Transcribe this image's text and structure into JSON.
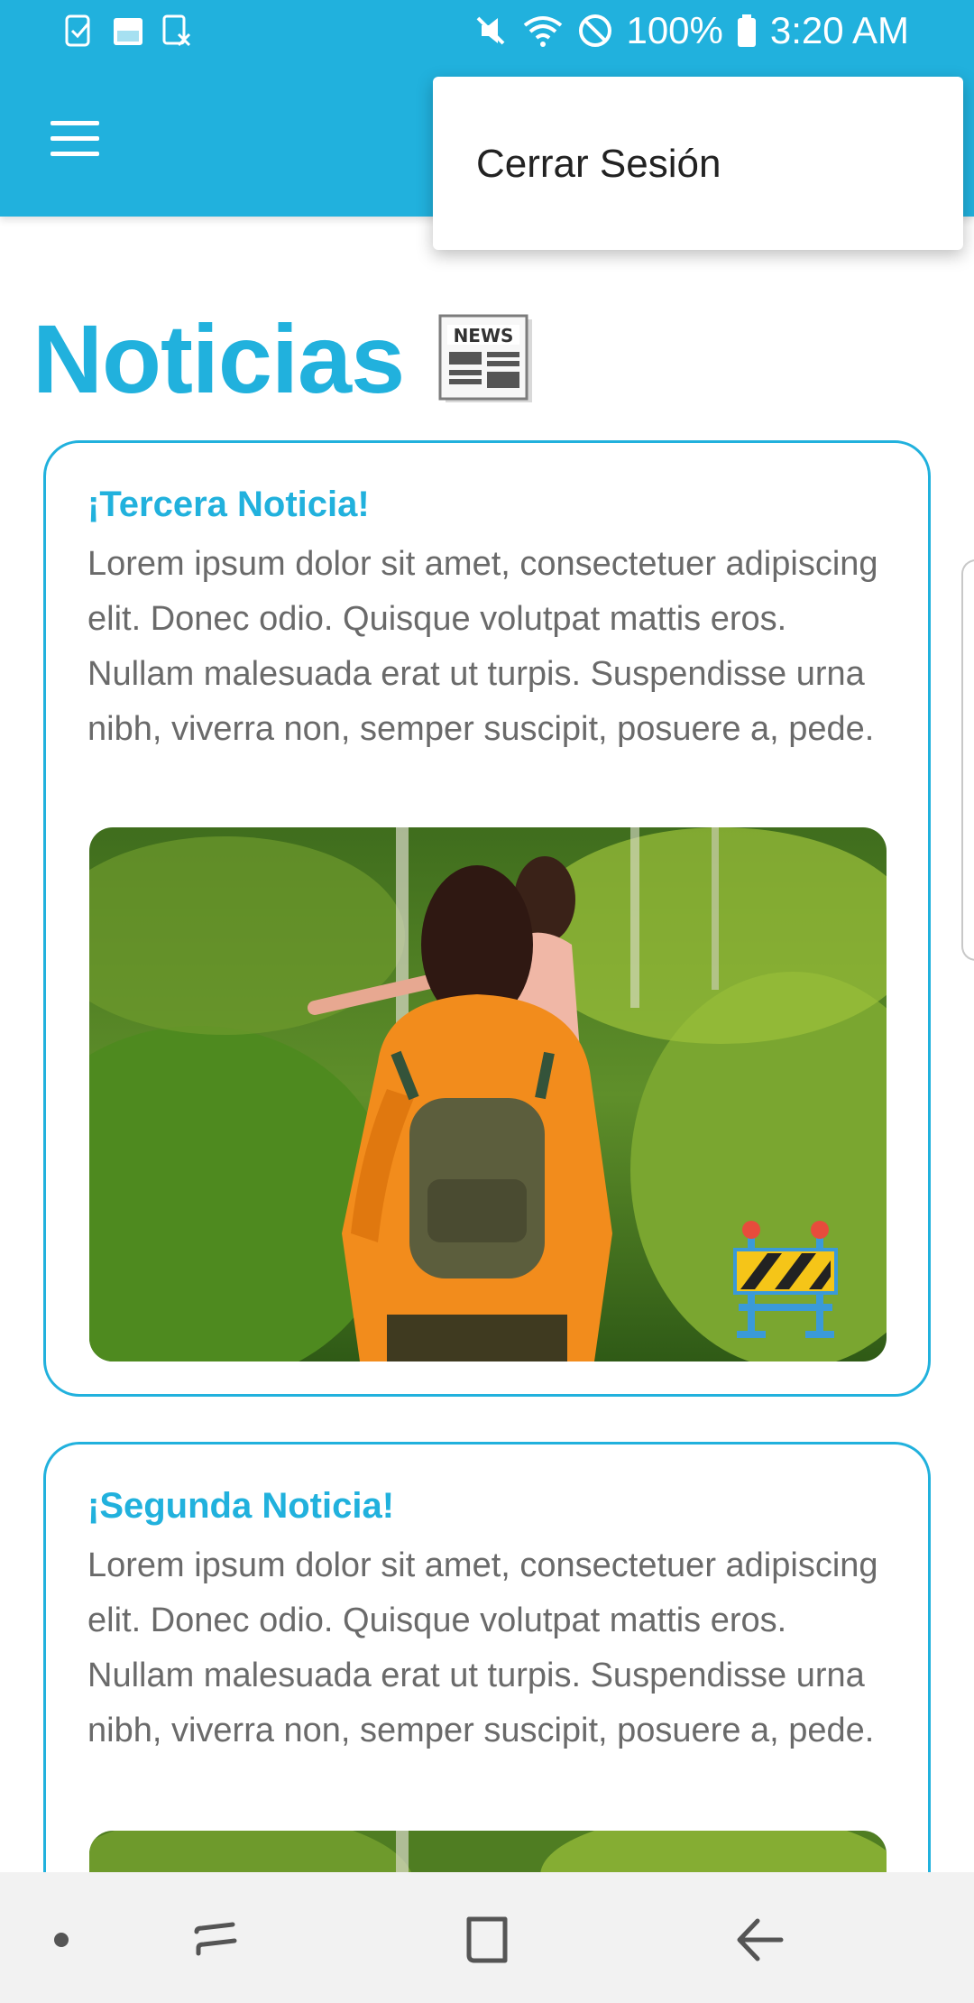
{
  "status_bar": {
    "battery": "100%",
    "time": "3:20 AM"
  },
  "menu": {
    "items": [
      "Cerrar Sesión"
    ]
  },
  "page": {
    "title": "Noticias",
    "title_icon": "newspaper-icon"
  },
  "news": [
    {
      "title": "¡Tercera Noticia!",
      "body": "Lorem ipsum dolor sit amet, consectetuer adipiscing elit. Donec odio. Quisque volutpat mattis eros. Nullam malesuada erat ut turpis. Suspendisse urna nibh, viverra non, semper suscipit, posuere a, pede.",
      "badge_icon": "construction-barrier-icon"
    },
    {
      "title": "¡Segunda Noticia!",
      "body": "Lorem ipsum dolor sit amet, consectetuer adipiscing elit. Donec odio. Quisque volutpat mattis eros. Nullam malesuada erat ut turpis. Suspendisse urna nibh, viverra non, semper suscipit, posuere a, pede."
    }
  ],
  "colors": {
    "primary": "#21b1dd",
    "text": "#6a6a6a",
    "accent_light": "#a7e6f3"
  }
}
